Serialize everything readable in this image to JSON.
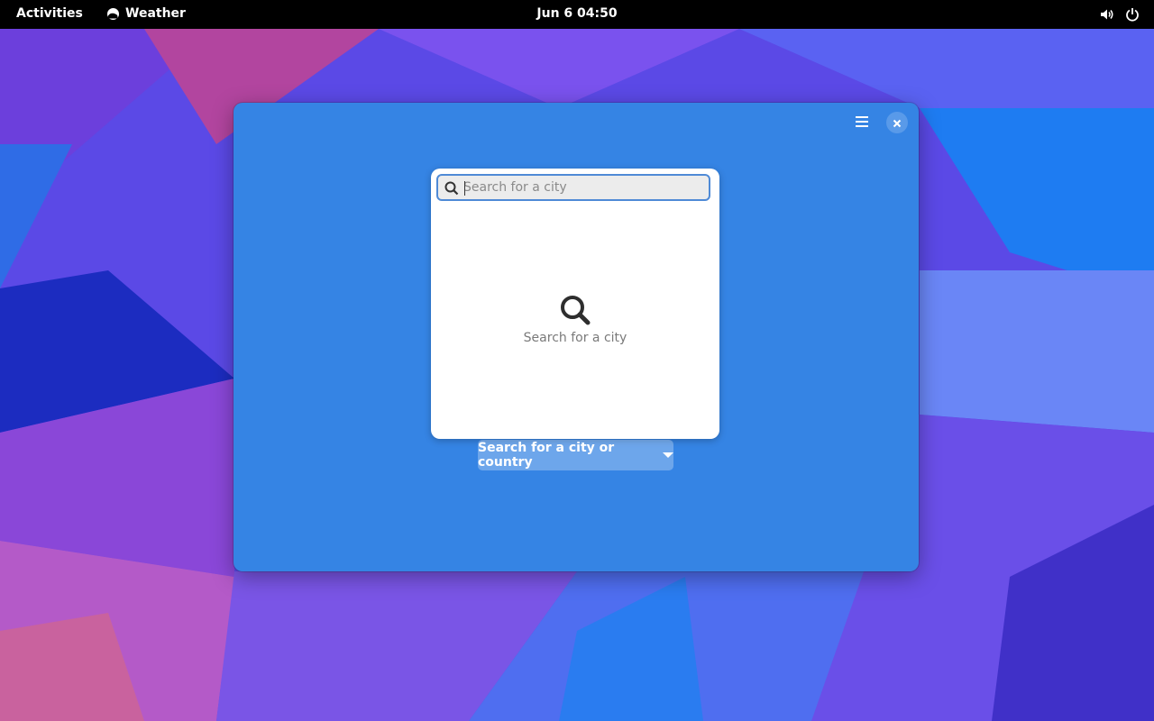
{
  "topbar": {
    "activities_label": "Activities",
    "app_name": "Weather",
    "clock": "Jun 6  04:50",
    "icons": [
      "weather-app-icon",
      "volume-icon",
      "power-icon"
    ]
  },
  "window": {
    "background_color": "#3584e4",
    "icons": [
      "hamburger-menu-icon",
      "close-icon"
    ]
  },
  "search": {
    "placeholder": "Search for a city",
    "value": "",
    "empty_state_label": "Search for a city",
    "icons": [
      "search-icon",
      "search-large-icon"
    ]
  },
  "location_dropdown": {
    "label": "Search for a city or country"
  }
}
